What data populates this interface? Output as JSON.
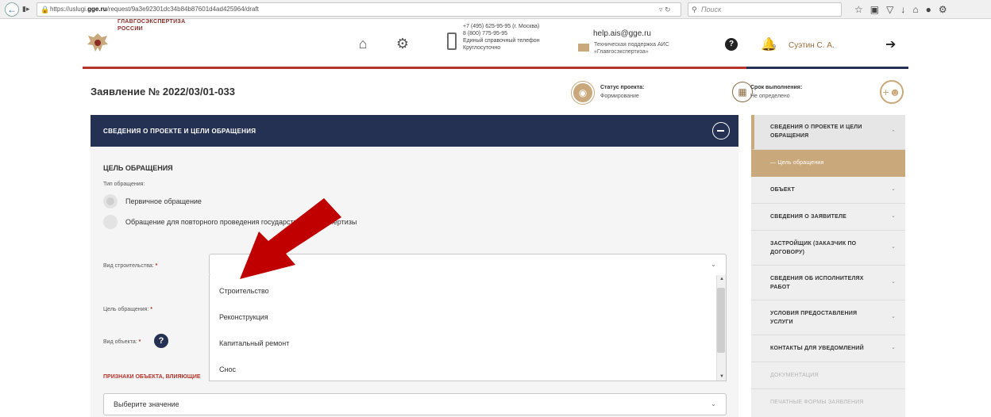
{
  "browser": {
    "url_prefix": "https://uslugi.",
    "url_domain": "gge.ru",
    "url_path": "/request/9a3e92301dc34b84b87601d4ad425964/draft",
    "search_placeholder": "Поиск"
  },
  "header": {
    "logo_line1": "ГЛАВГОСЭКСПЕРТИЗА",
    "logo_line2": "РОССИИ",
    "phone_line1": "+7 (495) 625-95-95 (г. Москва)",
    "phone_line2": "8 (800) 775-95-95",
    "phone_line3": "Единый справочный телефон",
    "phone_line4": "Круглосуточно",
    "help_email": "help.ais@gge.ru",
    "help_line1": "Техническая поддержка АИС",
    "help_line2": "«Главгосэкспертиза»",
    "notification_count": "9",
    "user_name": "Суэтин С. А."
  },
  "page": {
    "title": "Заявление № 2022/03/01-033",
    "status_label": "Статус проекта:",
    "status_value": "Формирование",
    "deadline_label": "Срок выполнения:",
    "deadline_value": "Не определено"
  },
  "section": {
    "title": "СВЕДЕНИЯ О ПРОЕКТЕ И ЦЕЛИ ОБРАЩЕНИЯ",
    "goal_heading": "ЦЕЛЬ ОБРАЩЕНИЯ",
    "type_label": "Тип обращения:",
    "radio_primary": "Первичное обращение",
    "radio_repeat": "Обращение для повторного проведения государственной экспертизы",
    "construction_label": "Вид строительства:",
    "goal_label": "Цель обращения:",
    "object_label": "Вид объекта:",
    "required_mark": "*",
    "signs_label": "ПРИЗНАКИ ОБЪЕКТА, ВЛИЯЮЩИЕ",
    "dropdown_options": [
      "Строительство",
      "Реконструкция",
      "Капитальный ремонт",
      "Снос"
    ],
    "select_placeholder": "Выберите значение"
  },
  "sidebar": {
    "items": [
      "СВЕДЕНИЯ О ПРОЕКТЕ И ЦЕЛИ ОБРАЩЕНИЯ",
      "— Цель обращения",
      "ОБЪЕКТ",
      "СВЕДЕНИЯ О ЗАЯВИТЕЛЕ",
      "ЗАСТРОЙЩИК (ЗАКАЗЧИК ПО ДОГОВОРУ)",
      "СВЕДЕНИЯ ОБ ИСПОЛНИТЕЛЯХ РАБОТ",
      "УСЛОВИЯ ПРЕДОСТАВЛЕНИЯ УСЛУГИ",
      "КОНТАКТЫ ДЛЯ УВЕДОМЛЕНИЙ",
      "ДОКУМЕНТАЦИЯ",
      "ПЕЧАТНЫЕ ФОРМЫ ЗАЯВЛЕНИЯ"
    ]
  },
  "colors": {
    "navy": "#243153",
    "gold": "#c9a87c",
    "brand_red": "#b5332a",
    "arrow_red": "#c00000"
  }
}
